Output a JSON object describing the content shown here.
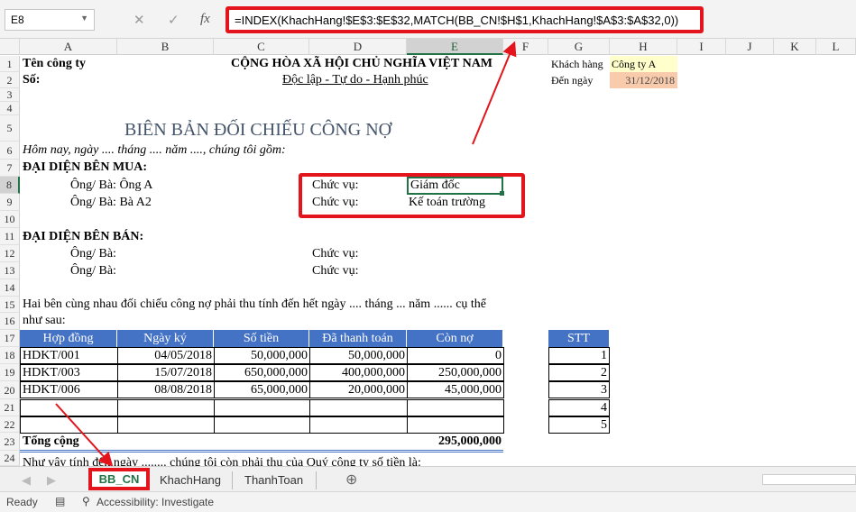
{
  "namebox": "E8",
  "formula": "=INDEX(KhachHang!$E$3:$E$32,MATCH(BB_CN!$H$1,KhachHang!$A$3:$A$32,0))",
  "fx_label": "fx",
  "columns": [
    "A",
    "B",
    "C",
    "D",
    "E",
    "F",
    "G",
    "H",
    "I",
    "J",
    "K",
    "L"
  ],
  "rows": [
    "1",
    "2",
    "3",
    "4",
    "5",
    "6",
    "7",
    "8",
    "9",
    "10",
    "11",
    "12",
    "13",
    "14",
    "15",
    "16",
    "17",
    "18",
    "19",
    "20",
    "21",
    "22",
    "23",
    "24"
  ],
  "sheet": {
    "company": "Tên công ty",
    "so": "Số:",
    "nation": "CỘNG HÒA XÃ HỘI CHỦ NGHĨA VIỆT NAM",
    "motto": "Độc lập - Tự do - Hạnh phúc",
    "kh_label": "Khách hàng",
    "kh_value": "Công ty A",
    "date_label": "Đến ngày",
    "date_value": "31/12/2018",
    "title": "BIÊN BẢN ĐỐI CHIẾU CÔNG NỢ",
    "intro": "Hôm nay, ngày .... tháng .... năm ...., chúng tôi gồm:",
    "buyer": "ĐẠI DIỆN BÊN MUA:",
    "buyer1": "Ông/ Bà: Ông A",
    "buyer2": "Ông/ Bà: Bà A2",
    "pos_label": "Chức vụ:",
    "pos1": "Giám đốc",
    "pos2": "Kế toán trường",
    "seller": "ĐẠI DIỆN BÊN BÁN:",
    "seller1": "Ông/ Bà:",
    "seller2": "Ông/ Bà:",
    "para1": "Hai bên cùng nhau đối chiếu công nợ phải thu tính đến hết ngày .... tháng ... năm ...... cụ thể",
    "para2": "như sau:",
    "headers": [
      "Hợp đồng",
      "Ngày ký",
      "Số tiền",
      "Đã thanh toán",
      "Còn nợ"
    ],
    "table": [
      [
        "HDKT/001",
        "04/05/2018",
        "50,000,000",
        "50,000,000",
        "0"
      ],
      [
        "HDKT/003",
        "15/07/2018",
        "650,000,000",
        "400,000,000",
        "250,000,000"
      ],
      [
        "HDKT/006",
        "08/08/2018",
        "65,000,000",
        "20,000,000",
        "45,000,000"
      ]
    ],
    "stt_header": "STT",
    "stt": [
      "1",
      "2",
      "3",
      "4",
      "5"
    ],
    "total_label": "Tổng cộng",
    "total_value": "295,000,000",
    "row24": "Như vậy tính đến ngày ........ chúng tôi còn phải thu của Quý công ty số tiền là:"
  },
  "tabs": [
    "BB_CN",
    "KhachHang",
    "ThanhToan"
  ],
  "status": {
    "ready": "Ready",
    "accessibility": "Accessibility: Investigate"
  },
  "colors": {
    "accent": "#217346",
    "highlight": "#e3141b",
    "table_header": "#4472c4"
  }
}
